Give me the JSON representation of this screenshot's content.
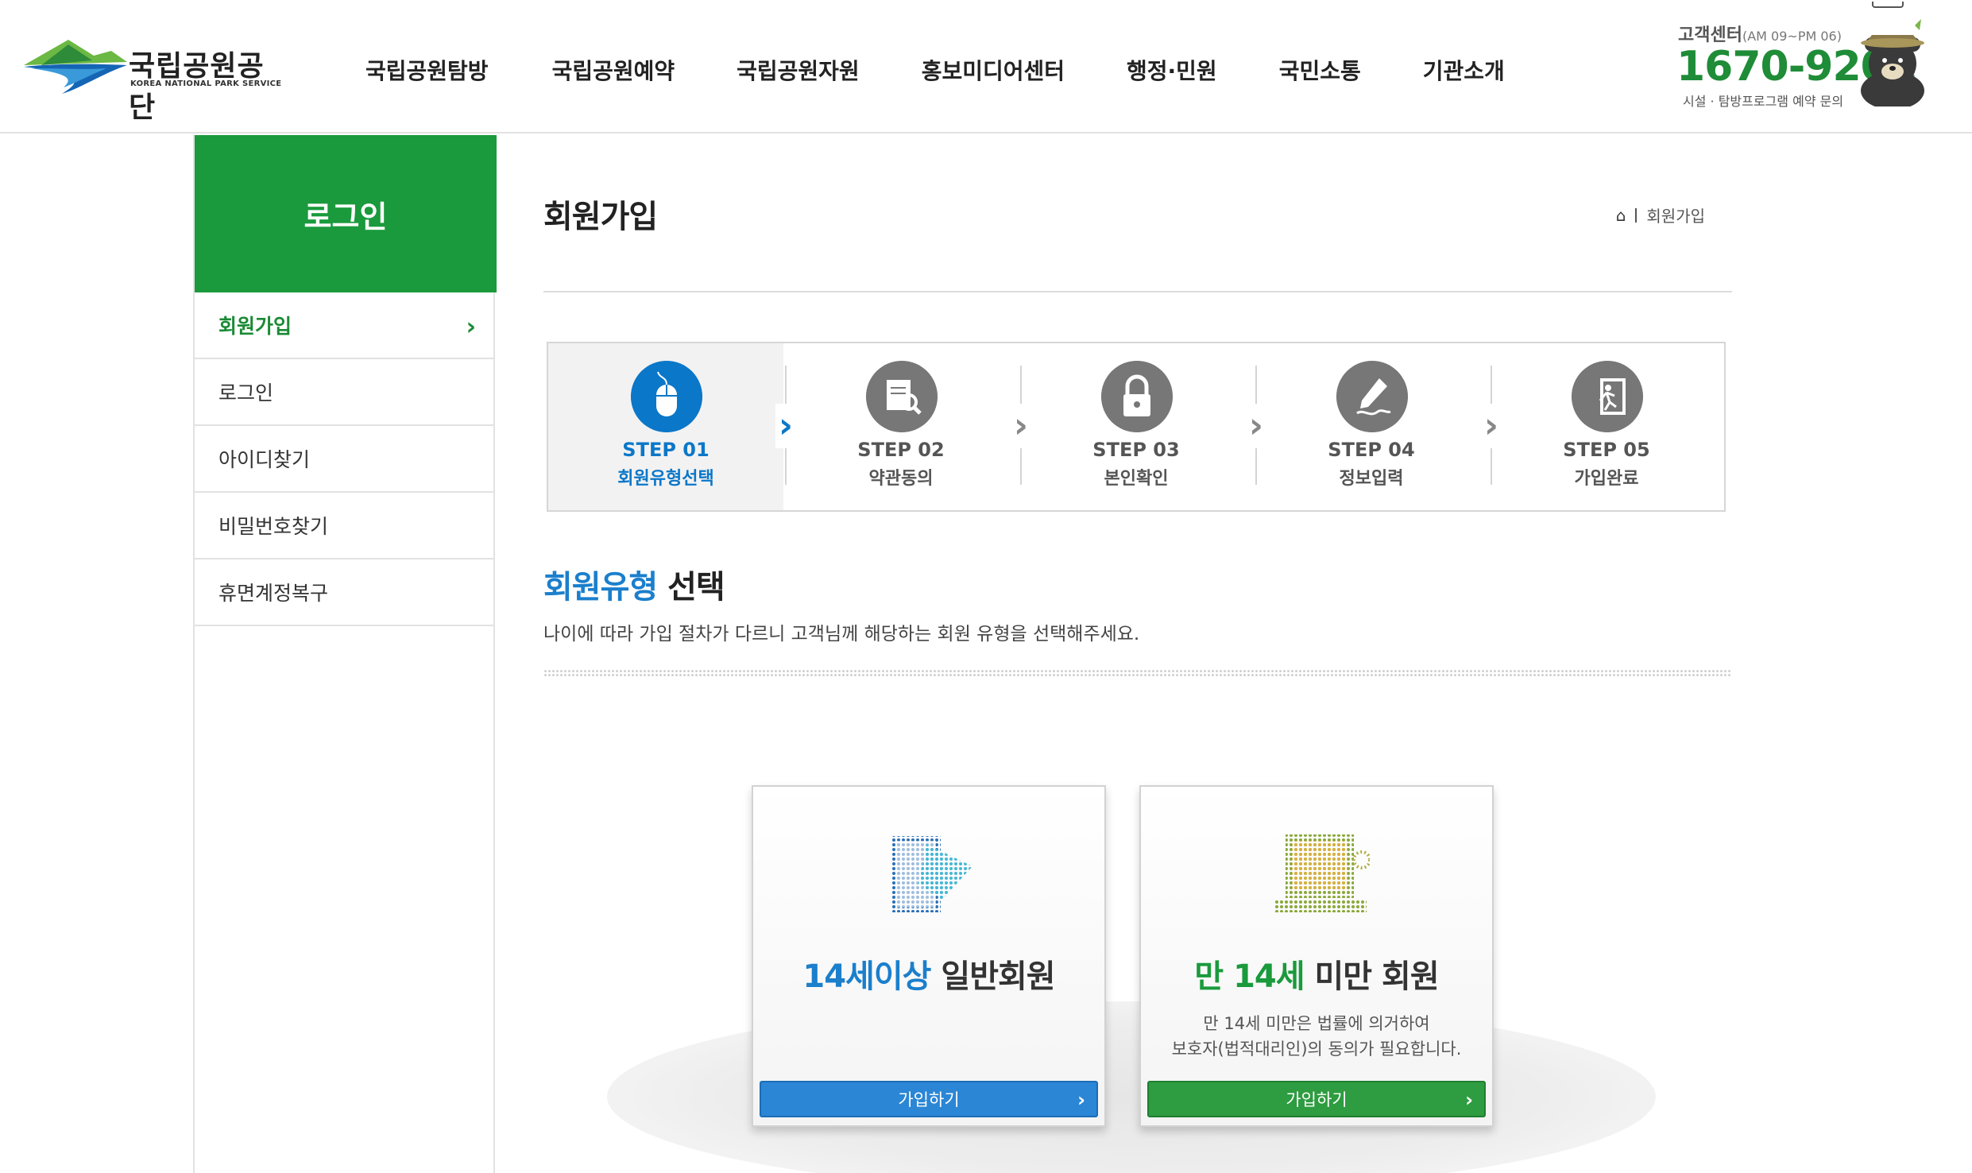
{
  "header": {
    "logo_ko": "국립공원공단",
    "logo_en": "KOREA NATIONAL PARK SERVICE",
    "nav": [
      "국립공원탐방",
      "국립공원예약",
      "국립공원자원",
      "홍보미디어센터",
      "행정·민원",
      "국민소통",
      "기관소개"
    ],
    "cs_title": "고객센터",
    "cs_hours": "(AM 09~PM 06)",
    "cs_phone": "1670-9201",
    "cs_sub": "시설 · 탐방프로그램 예약 문의"
  },
  "sidebar": {
    "title": "로그인",
    "items": [
      {
        "label": "회원가입",
        "active": true
      },
      {
        "label": "로그인"
      },
      {
        "label": "아이디찾기"
      },
      {
        "label": "비밀번호찾기"
      },
      {
        "label": "휴면계정복구"
      }
    ]
  },
  "main": {
    "title": "회원가입",
    "breadcrumb": "회원가입",
    "steps": [
      {
        "num": "STEP 01",
        "label": "회원유형선택",
        "active": true,
        "icon": "mouse-icon"
      },
      {
        "num": "STEP 02",
        "label": "약관동의",
        "icon": "document-search-icon"
      },
      {
        "num": "STEP 03",
        "label": "본인확인",
        "icon": "lock-icon"
      },
      {
        "num": "STEP 04",
        "label": "정보입력",
        "icon": "pen-icon"
      },
      {
        "num": "STEP 05",
        "label": "가입완료",
        "icon": "exit-door-icon"
      }
    ],
    "section_title_hl": "회원유형",
    "section_title_rest": " 선택",
    "section_desc": "나이에 따라 가입 절차가 다르니 고객님께 해당하는 회원 유형을 선택해주세요.",
    "cards": [
      {
        "title_hl": "14세이상",
        "title_rest": " 일반회원",
        "note_1": "",
        "note_2": "",
        "button": "가입하기"
      },
      {
        "title_hl": "만 14세",
        "title_rest": " 미만 회원",
        "note_1": "만 14세 미만은 법률에 의거하여",
        "note_2": "보호자(법적대리인)의 동의가 필요합니다.",
        "button": "가입하기"
      }
    ]
  },
  "colors": {
    "green": "#1a9a3c",
    "blue": "#1b7fcc",
    "active_step": "#0b77c9"
  }
}
